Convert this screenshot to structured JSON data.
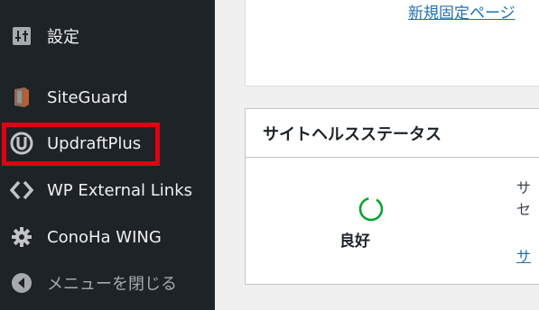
{
  "sidebar": {
    "items": [
      {
        "label": "設定",
        "icon": "settings-sliders-icon"
      },
      {
        "label": "SiteGuard",
        "icon": "siteguard-icon"
      },
      {
        "label": "UpdraftPlus",
        "icon": "updraftplus-icon"
      },
      {
        "label": "WP External Links",
        "icon": "external-links-icon"
      },
      {
        "label": "ConoHa WING",
        "icon": "gear-icon"
      },
      {
        "label": "メニューを閉じる",
        "icon": "collapse-arrow-icon"
      }
    ],
    "highlight_color": "#e00012"
  },
  "main": {
    "top_card": {
      "link": "新規固定ページ"
    },
    "health": {
      "title": "サイトヘルスステータス",
      "status": "良好",
      "status_color": "#00a32a",
      "side_line1": "サ",
      "side_line2": "セ",
      "side_link": "サ"
    }
  }
}
